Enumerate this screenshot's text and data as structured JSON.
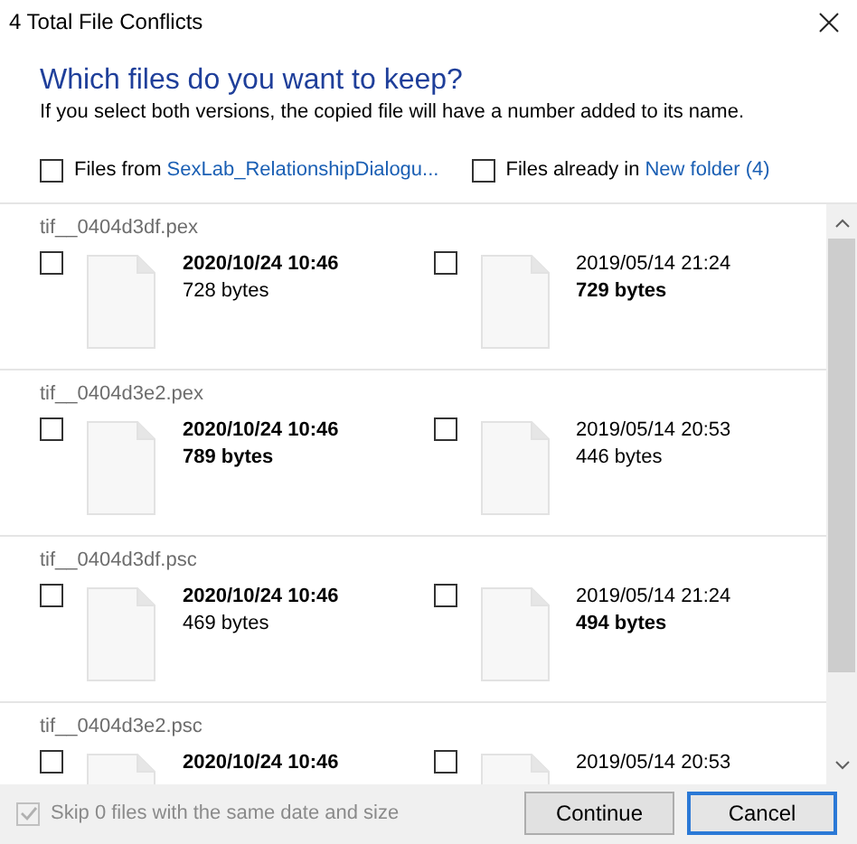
{
  "window": {
    "title": "4 Total File Conflicts"
  },
  "heading": "Which files do you want to keep?",
  "description": "If you select both versions, the copied file will have a number added to its name.",
  "select_all": [
    {
      "label": "Files from",
      "link": "SexLab_RelationshipDialogu...",
      "checked": false
    },
    {
      "label": "Files already in",
      "link": "New folder (4)",
      "checked": false
    }
  ],
  "conflicts": [
    {
      "name": "tif__0404d3df.pex",
      "versions": [
        {
          "checked": false,
          "date": "2020/10/24 10:46",
          "date_bold": true,
          "size": "728 bytes",
          "size_bold": false
        },
        {
          "checked": false,
          "date": "2019/05/14 21:24",
          "date_bold": false,
          "size": "729 bytes",
          "size_bold": true
        }
      ]
    },
    {
      "name": "tif__0404d3e2.pex",
      "versions": [
        {
          "checked": false,
          "date": "2020/10/24 10:46",
          "date_bold": true,
          "size": "789 bytes",
          "size_bold": true
        },
        {
          "checked": false,
          "date": "2019/05/14 20:53",
          "date_bold": false,
          "size": "446 bytes",
          "size_bold": false
        }
      ]
    },
    {
      "name": "tif__0404d3df.psc",
      "versions": [
        {
          "checked": false,
          "date": "2020/10/24 10:46",
          "date_bold": true,
          "size": "469 bytes",
          "size_bold": false
        },
        {
          "checked": false,
          "date": "2019/05/14 21:24",
          "date_bold": false,
          "size": "494 bytes",
          "size_bold": true
        }
      ]
    },
    {
      "name": "tif__0404d3e2.psc",
      "versions": [
        {
          "checked": false,
          "date": "2020/10/24 10:46",
          "date_bold": true
        },
        {
          "checked": false,
          "date": "2019/05/14 20:53",
          "date_bold": false
        }
      ]
    }
  ],
  "skip": {
    "label": "Skip 0 files with the same date and size",
    "checked": true,
    "disabled": true
  },
  "buttons": [
    {
      "label": "Continue",
      "kind": "secondary"
    },
    {
      "label": "Cancel",
      "kind": "default"
    }
  ]
}
